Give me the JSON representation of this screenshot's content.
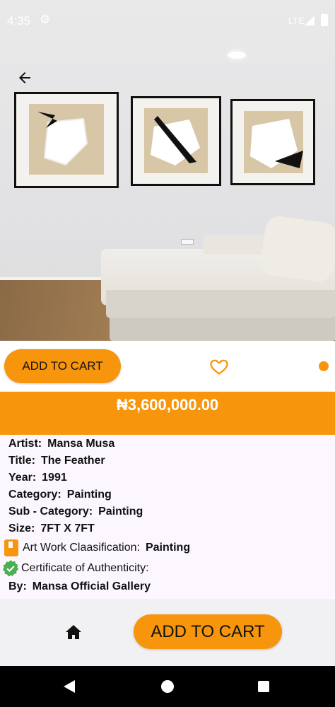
{
  "status_bar": {
    "time": "4:35",
    "settings_icon": "gear-icon",
    "network": "LTE",
    "signal_icon": "signal-icon",
    "battery_icon": "battery-icon"
  },
  "navigation": {
    "back_icon": "arrow-left-icon",
    "back_glyph": "←"
  },
  "actions": {
    "add_to_cart_label": "ADD TO CART",
    "favorite_icon": "heart-icon"
  },
  "price": "₦3,600,000.00",
  "details": {
    "artist_label": "Artist:",
    "artist": "Mansa Musa",
    "title_label": "Title:",
    "title": "The Feather",
    "year_label": "Year:",
    "year": "1991",
    "category_label": "Category:",
    "category": "Painting",
    "subcategory_label": "Sub - Category:",
    "subcategory": "Painting",
    "size_label": "Size:",
    "size": "7FT X 7FT",
    "classification_label": "Art Work Claasification:",
    "classification": "Painting",
    "certificate_label": "Certificate of Authenticity:",
    "by_label": "By:",
    "by": "Mansa Official Gallery"
  },
  "bottom_bar": {
    "home_icon": "home-icon",
    "add_to_cart_label": "ADD TO CART"
  },
  "system_nav": {
    "back_icon": "nav-back-icon",
    "home_icon": "nav-home-icon",
    "recents_icon": "nav-recents-icon"
  },
  "colors": {
    "accent": "#f7960c",
    "details_bg": "#fcf7ff",
    "bottom_bg": "#f1f1f3"
  }
}
